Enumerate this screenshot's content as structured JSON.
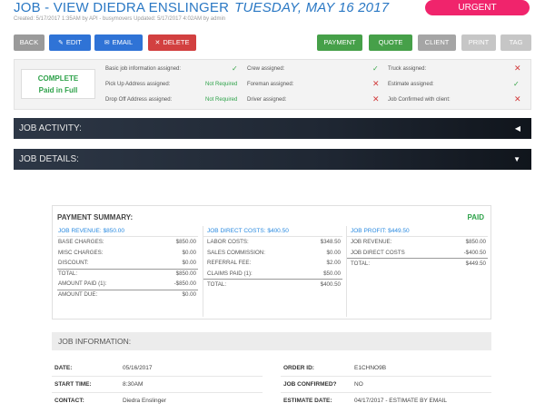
{
  "header": {
    "title": "JOB - VIEW DIEDRA ENSLINGER",
    "date": "TUESDAY, MAY 16 2017",
    "urgent_label": "URGENT",
    "meta": "Created: 5/17/2017 1:35AM by API - busymovers Updated: 5/17/2017 4:02AM by admin"
  },
  "toolbar": {
    "back": "BACK",
    "edit": "EDIT",
    "email": "EMAIL",
    "delete": "DELETE",
    "payment": "PAYMENT",
    "quote": "QUOTE",
    "client": "CLIENT",
    "print": "PRINT",
    "tag": "TAG"
  },
  "status": {
    "complete": "COMPLETE",
    "paid_in_full": "Paid in Full",
    "items": {
      "basic_info": "Basic job information assigned:",
      "pickup": "Pick Up Address assigned:",
      "dropoff": "Drop Off Address assigned:",
      "crew": "Crew assigned:",
      "foreman": "Foreman assigned:",
      "driver": "Driver assigned:",
      "truck": "Truck assigned:",
      "estimate": "Estimate assigned:",
      "confirmed": "Job Confirmed with client:"
    },
    "not_required": "Not Required"
  },
  "sections": {
    "activity": "JOB ACTIVITY:",
    "details": "JOB DETAILS:"
  },
  "payment": {
    "title": "PAYMENT SUMMARY:",
    "paid": "PAID",
    "revenue": {
      "head": "JOB REVENUE: $850.00",
      "rows": [
        {
          "label": "BASE CHARGES:",
          "value": "$850.00"
        },
        {
          "label": "MISC CHARGES:",
          "value": "$0.00"
        },
        {
          "label": "DISCOUNT:",
          "value": "$0.00"
        },
        {
          "label": "TOTAL:",
          "value": "$850.00"
        },
        {
          "label": "AMOUNT PAID (1):",
          "value": "-$850.00"
        },
        {
          "label": "AMOUNT DUE:",
          "value": "$0.00"
        }
      ]
    },
    "costs": {
      "head": "JOB DIRECT COSTS: $400.50",
      "rows": [
        {
          "label": "LABOR COSTS:",
          "value": "$348.50"
        },
        {
          "label": "SALES COMMISSION:",
          "value": "$0.00"
        },
        {
          "label": "REFERRAL FEE:",
          "value": "$2.00"
        },
        {
          "label": "CLAIMS PAID (1):",
          "value": "$50.00"
        },
        {
          "label": "TOTAL:",
          "value": "$400.50"
        }
      ]
    },
    "profit": {
      "head": "JOB PROFIT: $449.50",
      "rows": [
        {
          "label": "JOB REVENUE:",
          "value": "$850.00"
        },
        {
          "label": "JOB DIRECT COSTS",
          "value": "-$400.50"
        },
        {
          "label": "TOTAL:",
          "value": "$449.50"
        }
      ]
    }
  },
  "job_info": {
    "title": "JOB INFORMATION:",
    "date_label": "DATE:",
    "date": "05/16/2017",
    "start_label": "START TIME:",
    "start": "8:30AM",
    "contact_label": "CONTACT:",
    "contact": "Diedra Enslinger",
    "order_label": "ORDER ID:",
    "order": "E1CHNO9B",
    "confirmed_label": "JOB CONFIRMED?",
    "confirmed": "NO",
    "estimate_label": "ESTIMATE DATE:",
    "estimate": "04/17/2017 - ESTIMATE BY EMAIL"
  }
}
